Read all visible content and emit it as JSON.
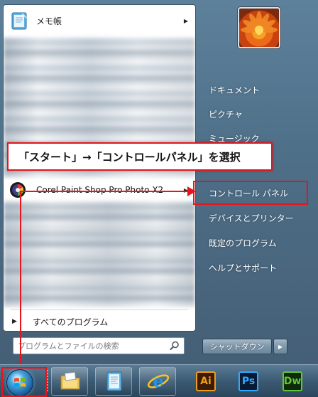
{
  "left_pane": {
    "pinned": {
      "label": "メモ帳"
    },
    "corel": {
      "label": "Corel Paint Shop Pro Photo X2"
    },
    "all_programs": "すべてのプログラム",
    "search_placeholder": "プログラムとファイルの検索"
  },
  "right_pane": {
    "items": [
      {
        "label": "ドキュメント"
      },
      {
        "label": "ピクチャ"
      },
      {
        "label": "ミュージック"
      },
      {
        "label": "コントロール パネル"
      },
      {
        "label": "デバイスとプリンター"
      },
      {
        "label": "既定のプログラム"
      },
      {
        "label": "ヘルプとサポート"
      }
    ],
    "shutdown_label": "シャットダウン"
  },
  "callout": {
    "text": "「スタート」→「コントロールパネル」を選択",
    "color": "#e8141b"
  },
  "taskbar": {
    "apps": [
      {
        "name": "explorer"
      },
      {
        "name": "notepad"
      },
      {
        "name": "internet-explorer"
      },
      {
        "name": "illustrator",
        "label": "Ai"
      },
      {
        "name": "photoshop",
        "label": "Ps"
      },
      {
        "name": "dreamweaver",
        "label": "Dw"
      }
    ]
  }
}
